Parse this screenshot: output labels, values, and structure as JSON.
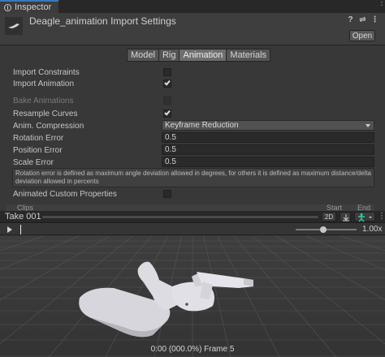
{
  "window": {
    "tab_label": "Inspector"
  },
  "header": {
    "title": "Deagle_animation Import Settings",
    "open_label": "Open"
  },
  "tabs": [
    {
      "label": "Model"
    },
    {
      "label": "Rig"
    },
    {
      "label": "Animation"
    },
    {
      "label": "Materials"
    }
  ],
  "properties": {
    "import_constraints": {
      "label": "Import Constraints",
      "checked": false
    },
    "import_animation": {
      "label": "Import Animation",
      "checked": true
    },
    "bake_animations": {
      "label": "Bake Animations",
      "checked": false,
      "disabled": true
    },
    "resample_curves": {
      "label": "Resample Curves",
      "checked": true
    },
    "anim_compression": {
      "label": "Anim. Compression",
      "value": "Keyframe Reduction"
    },
    "rotation_error": {
      "label": "Rotation Error",
      "value": "0.5"
    },
    "position_error": {
      "label": "Position Error",
      "value": "0.5"
    },
    "scale_error": {
      "label": "Scale Error",
      "value": "0.5"
    },
    "help_text": "Rotation error is defined as maximum angle deviation allowed in degrees, for others it is defined as maximum distance/delta deviation allowed in percents",
    "animated_custom_properties": {
      "label": "Animated Custom Properties",
      "checked": false
    }
  },
  "clips": {
    "label": "Clips",
    "start_label": "Start",
    "end_label": "End"
  },
  "preview": {
    "take_label": "Take 001",
    "mode_2d": "2D",
    "speed": "1.00x",
    "speed_fraction": 0.45,
    "status": "0:00 (000.0%) Frame 5"
  },
  "colors": {
    "accent": "#3a79bb",
    "avatar_icon": "#38c8a8",
    "background": "#383838",
    "viewport": "#3a3a3a"
  }
}
